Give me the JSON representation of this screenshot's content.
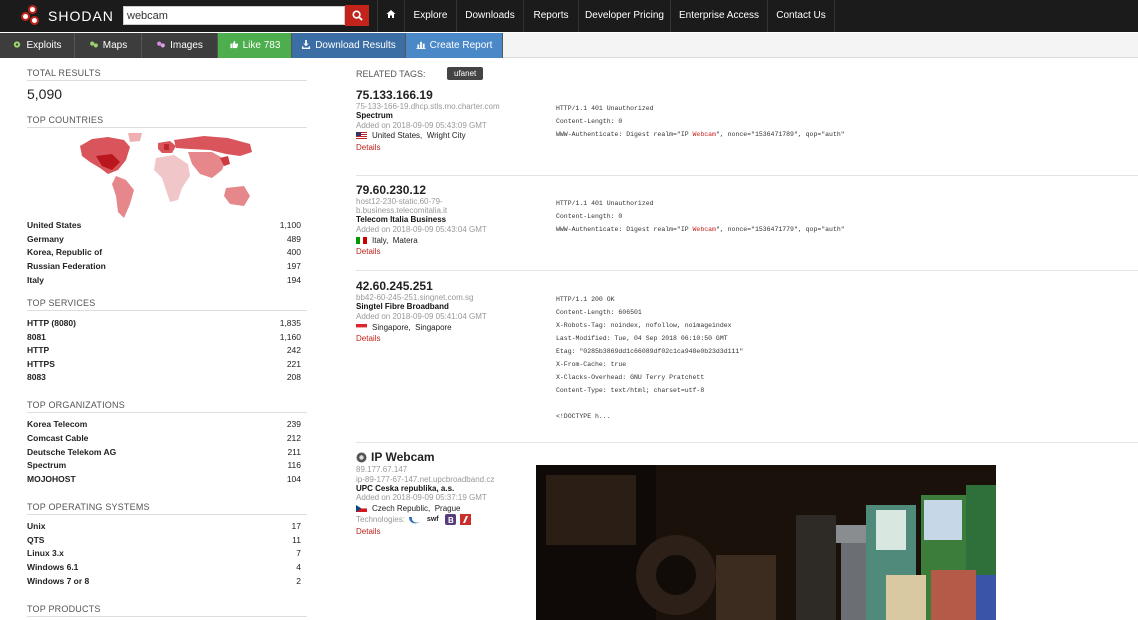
{
  "app": {
    "name": "SHODAN"
  },
  "search": {
    "value": "webcam"
  },
  "nav": [
    "Explore",
    "Downloads",
    "Reports",
    "Developer Pricing",
    "Enterprise Access",
    "Contact Us"
  ],
  "subnav": {
    "exploits": "Exploits",
    "maps": "Maps",
    "images": "Images",
    "like": "Like 783",
    "download": "Download Results",
    "report": "Create Report"
  },
  "sidebar": {
    "total_label": "TOTAL RESULTS",
    "total_value": "5,090",
    "countries_label": "TOP COUNTRIES",
    "countries": [
      {
        "name": "United States",
        "count": "1,100"
      },
      {
        "name": "Germany",
        "count": "489"
      },
      {
        "name": "Korea, Republic of",
        "count": "400"
      },
      {
        "name": "Russian Federation",
        "count": "197"
      },
      {
        "name": "Italy",
        "count": "194"
      }
    ],
    "services_label": "TOP SERVICES",
    "services": [
      {
        "name": "HTTP (8080)",
        "count": "1,835"
      },
      {
        "name": "8081",
        "count": "1,160"
      },
      {
        "name": "HTTP",
        "count": "242"
      },
      {
        "name": "HTTPS",
        "count": "221"
      },
      {
        "name": "8083",
        "count": "208"
      }
    ],
    "orgs_label": "TOP ORGANIZATIONS",
    "orgs": [
      {
        "name": "Korea Telecom",
        "count": "239"
      },
      {
        "name": "Comcast Cable",
        "count": "212"
      },
      {
        "name": "Deutsche Telekom AG",
        "count": "211"
      },
      {
        "name": "Spectrum",
        "count": "116"
      },
      {
        "name": "MOJOHOST",
        "count": "104"
      }
    ],
    "os_label": "TOP OPERATING SYSTEMS",
    "os": [
      {
        "name": "Unix",
        "count": "17"
      },
      {
        "name": "QTS",
        "count": "11"
      },
      {
        "name": "Linux 3.x",
        "count": "7"
      },
      {
        "name": "Windows 6.1",
        "count": "4"
      },
      {
        "name": "Windows 7 or 8",
        "count": "2"
      }
    ],
    "products_label": "TOP PRODUCTS"
  },
  "related": {
    "label": "RELATED TAGS:",
    "tag": "ufanet"
  },
  "results": [
    {
      "ip": "75.133.166.19",
      "host": "75-133-166-19.dhcp.stls.mo.charter.com",
      "org": "Spectrum",
      "added": "Added on 2018-09-09 05:43:09 GMT",
      "country": "United States,",
      "city": "Wright City",
      "details": "Details",
      "banner": [
        "HTTP/1.1 401 Unauthorized",
        "Content-Length: 0",
        "WWW-Authenticate: Digest realm=\"IP ",
        "Webcam",
        "\", nonce=\"1536471789\", qop=\"auth\""
      ]
    },
    {
      "ip": "79.60.230.12",
      "host": "host12-230-static.60-79-b.business.telecomitalia.it",
      "org": "Telecom Italia Business",
      "added": "Added on 2018-09-09 05:43:04 GMT",
      "country": "Italy,",
      "city": "Matera",
      "details": "Details",
      "banner": [
        "HTTP/1.1 401 Unauthorized",
        "Content-Length: 0",
        "WWW-Authenticate: Digest realm=\"IP ",
        "Webcam",
        "\", nonce=\"1536471779\", qop=\"auth\""
      ]
    },
    {
      "ip": "42.60.245.251",
      "host": "bb42-60-245-251.singnet.com.sg",
      "org": "Singtel Fibre Broadband",
      "added": "Added on 2018-09-09 05:41:04 GMT",
      "country": "Singapore,",
      "city": "Singapore",
      "details": "Details",
      "banner": [
        "HTTP/1.1 200 OK",
        "Content-Length: 606501",
        "X-Robots-Tag: noindex, nofollow, noimageindex",
        "Last-Modified: Tue, 04 Sep 2018 06:10:50 GMT",
        "Etag: \"0285b3869dd1c66089df02c1ca948e0b23d3d111\"",
        "X-From-Cache: true",
        "X-Clacks-Overhead: GNU Terry Pratchett",
        "Content-Type: text/html; charset=utf-8",
        "",
        "<!DOCTYPE h..."
      ]
    },
    {
      "title": "IP Webcam",
      "ip": "89.177.67.147",
      "host": "ip-89-177-67-147.net.upcbroadband.cz",
      "org": "UPC Ceska republika, a.s.",
      "added": "Added on 2018-09-09 05:37:19 GMT",
      "country": "Czech Republic,",
      "city": "Prague",
      "tech_label": "Technologies:",
      "details": "Details",
      "tech": [
        "swf"
      ]
    }
  ],
  "colors": {
    "brand": "#c2241c",
    "like": "#4cae4c",
    "download": "#3a6ea5",
    "report": "#4a88c8"
  }
}
